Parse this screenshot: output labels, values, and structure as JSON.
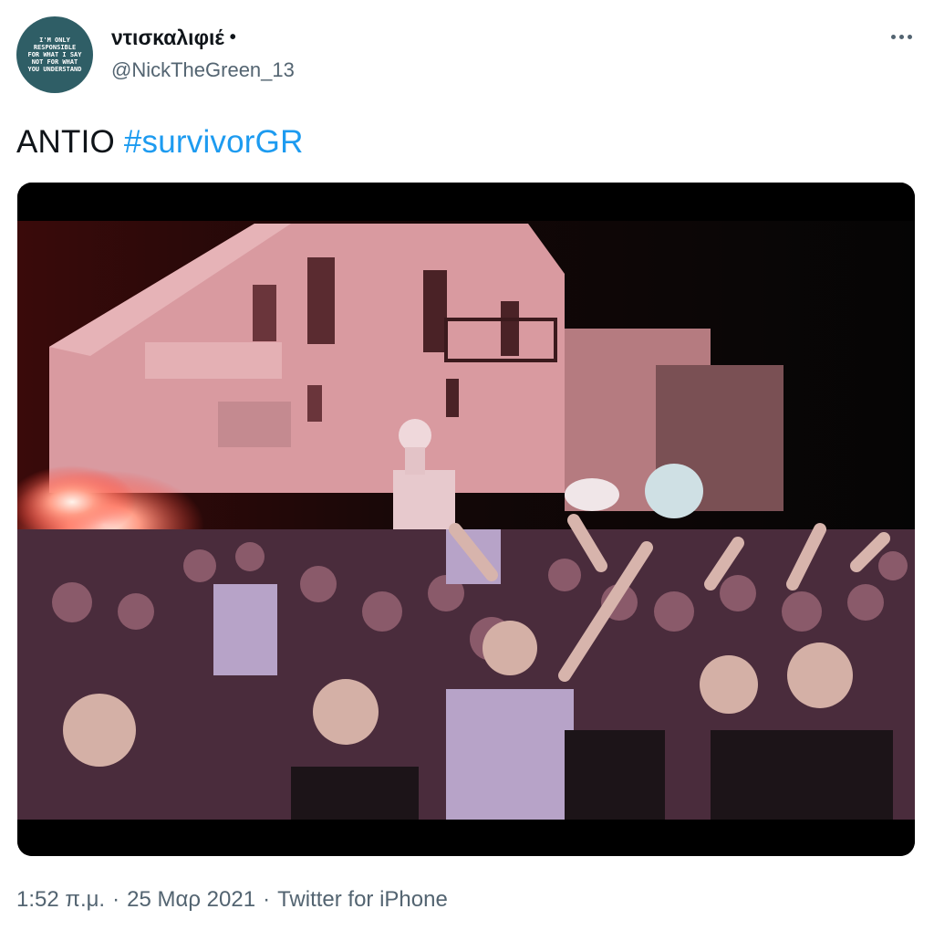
{
  "author": {
    "display_name": "ντισκαλιφιέ",
    "name_suffix": "•",
    "handle": "@NickTheGreen_13",
    "avatar_text": "I'M ONLY\nRESPONSIBLE\nFOR WHAT I SAY\nNOT FOR WHAT\nYOU UNDERSTAND"
  },
  "more_icon": "more-dots-icon",
  "tweet": {
    "text": "ANTIO ",
    "hashtag": "#survivorGR"
  },
  "media": {
    "description_icon": "photo-crowd-night"
  },
  "meta": {
    "time": "1:52 π.μ.",
    "separator1": "·",
    "date": "25 Μαρ 2021",
    "separator2": "·",
    "source": "Twitter for iPhone"
  },
  "colors": {
    "link": "#1d9bf0",
    "secondary": "#536471",
    "text": "#0f1419"
  }
}
